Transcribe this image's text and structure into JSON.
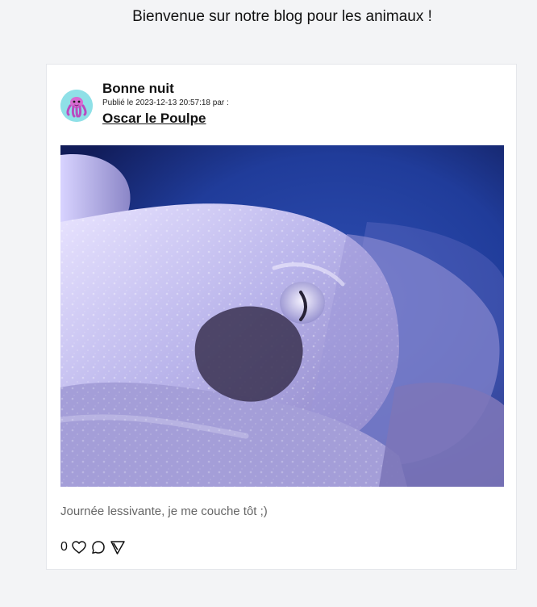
{
  "header": {
    "title": "Bienvenue sur notre blog pour les animaux !"
  },
  "post": {
    "title": "Bonne nuit",
    "meta": "Publié le 2023-12-13 20:57:18 par :",
    "author": "Oscar le Poulpe",
    "body": "Journée lessivante, je me couche tôt ;)",
    "like_count": "0",
    "avatar_icon": "octopus-icon",
    "image_subject": "octopus"
  },
  "actions": {
    "like_icon": "heart-icon",
    "comment_icon": "comment-icon",
    "share_icon": "send-icon"
  },
  "colors": {
    "background": "#f3f4f6",
    "card": "#ffffff",
    "avatar_bg": "#8fe0e7",
    "body_text": "#666666"
  }
}
